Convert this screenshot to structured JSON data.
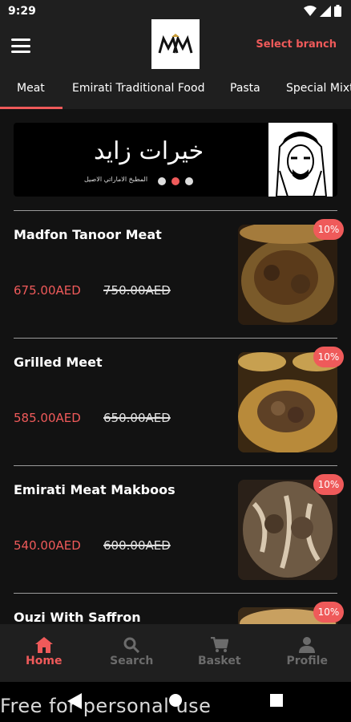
{
  "status": {
    "time": "9:29"
  },
  "header": {
    "logo": "MM",
    "select_branch": "Select branch"
  },
  "tabs": [
    {
      "label": "Meat",
      "active": true
    },
    {
      "label": "Emirati Traditional Food"
    },
    {
      "label": "Pasta"
    },
    {
      "label": "Special Mixt"
    }
  ],
  "banner": {
    "title": "خيرات زايد",
    "subtitle": "المطبخ الاماراتي الاصيل"
  },
  "items": [
    {
      "name": "Madfon Tanoor Meat",
      "price": "675.00AED",
      "old_price": "750.00AED",
      "discount": "10%"
    },
    {
      "name": "Grilled Meet",
      "price": "585.00AED",
      "old_price": "650.00AED",
      "discount": "10%"
    },
    {
      "name": "Emirati Meat Makboos",
      "price": "540.00AED",
      "old_price": "600.00AED",
      "discount": "10%"
    },
    {
      "name": "Ouzi With Saffron",
      "price": "",
      "old_price": "",
      "discount": "10%"
    }
  ],
  "nav": [
    {
      "label": "Home",
      "icon": "home-icon"
    },
    {
      "label": "Search",
      "icon": "search-icon"
    },
    {
      "label": "Basket",
      "icon": "cart-icon"
    },
    {
      "label": "Profile",
      "icon": "profile-icon"
    }
  ],
  "watermark": "Free for personal use",
  "colors": {
    "accent": "#ef5a5a",
    "surface": "#1f1f1f",
    "background": "#121212"
  }
}
